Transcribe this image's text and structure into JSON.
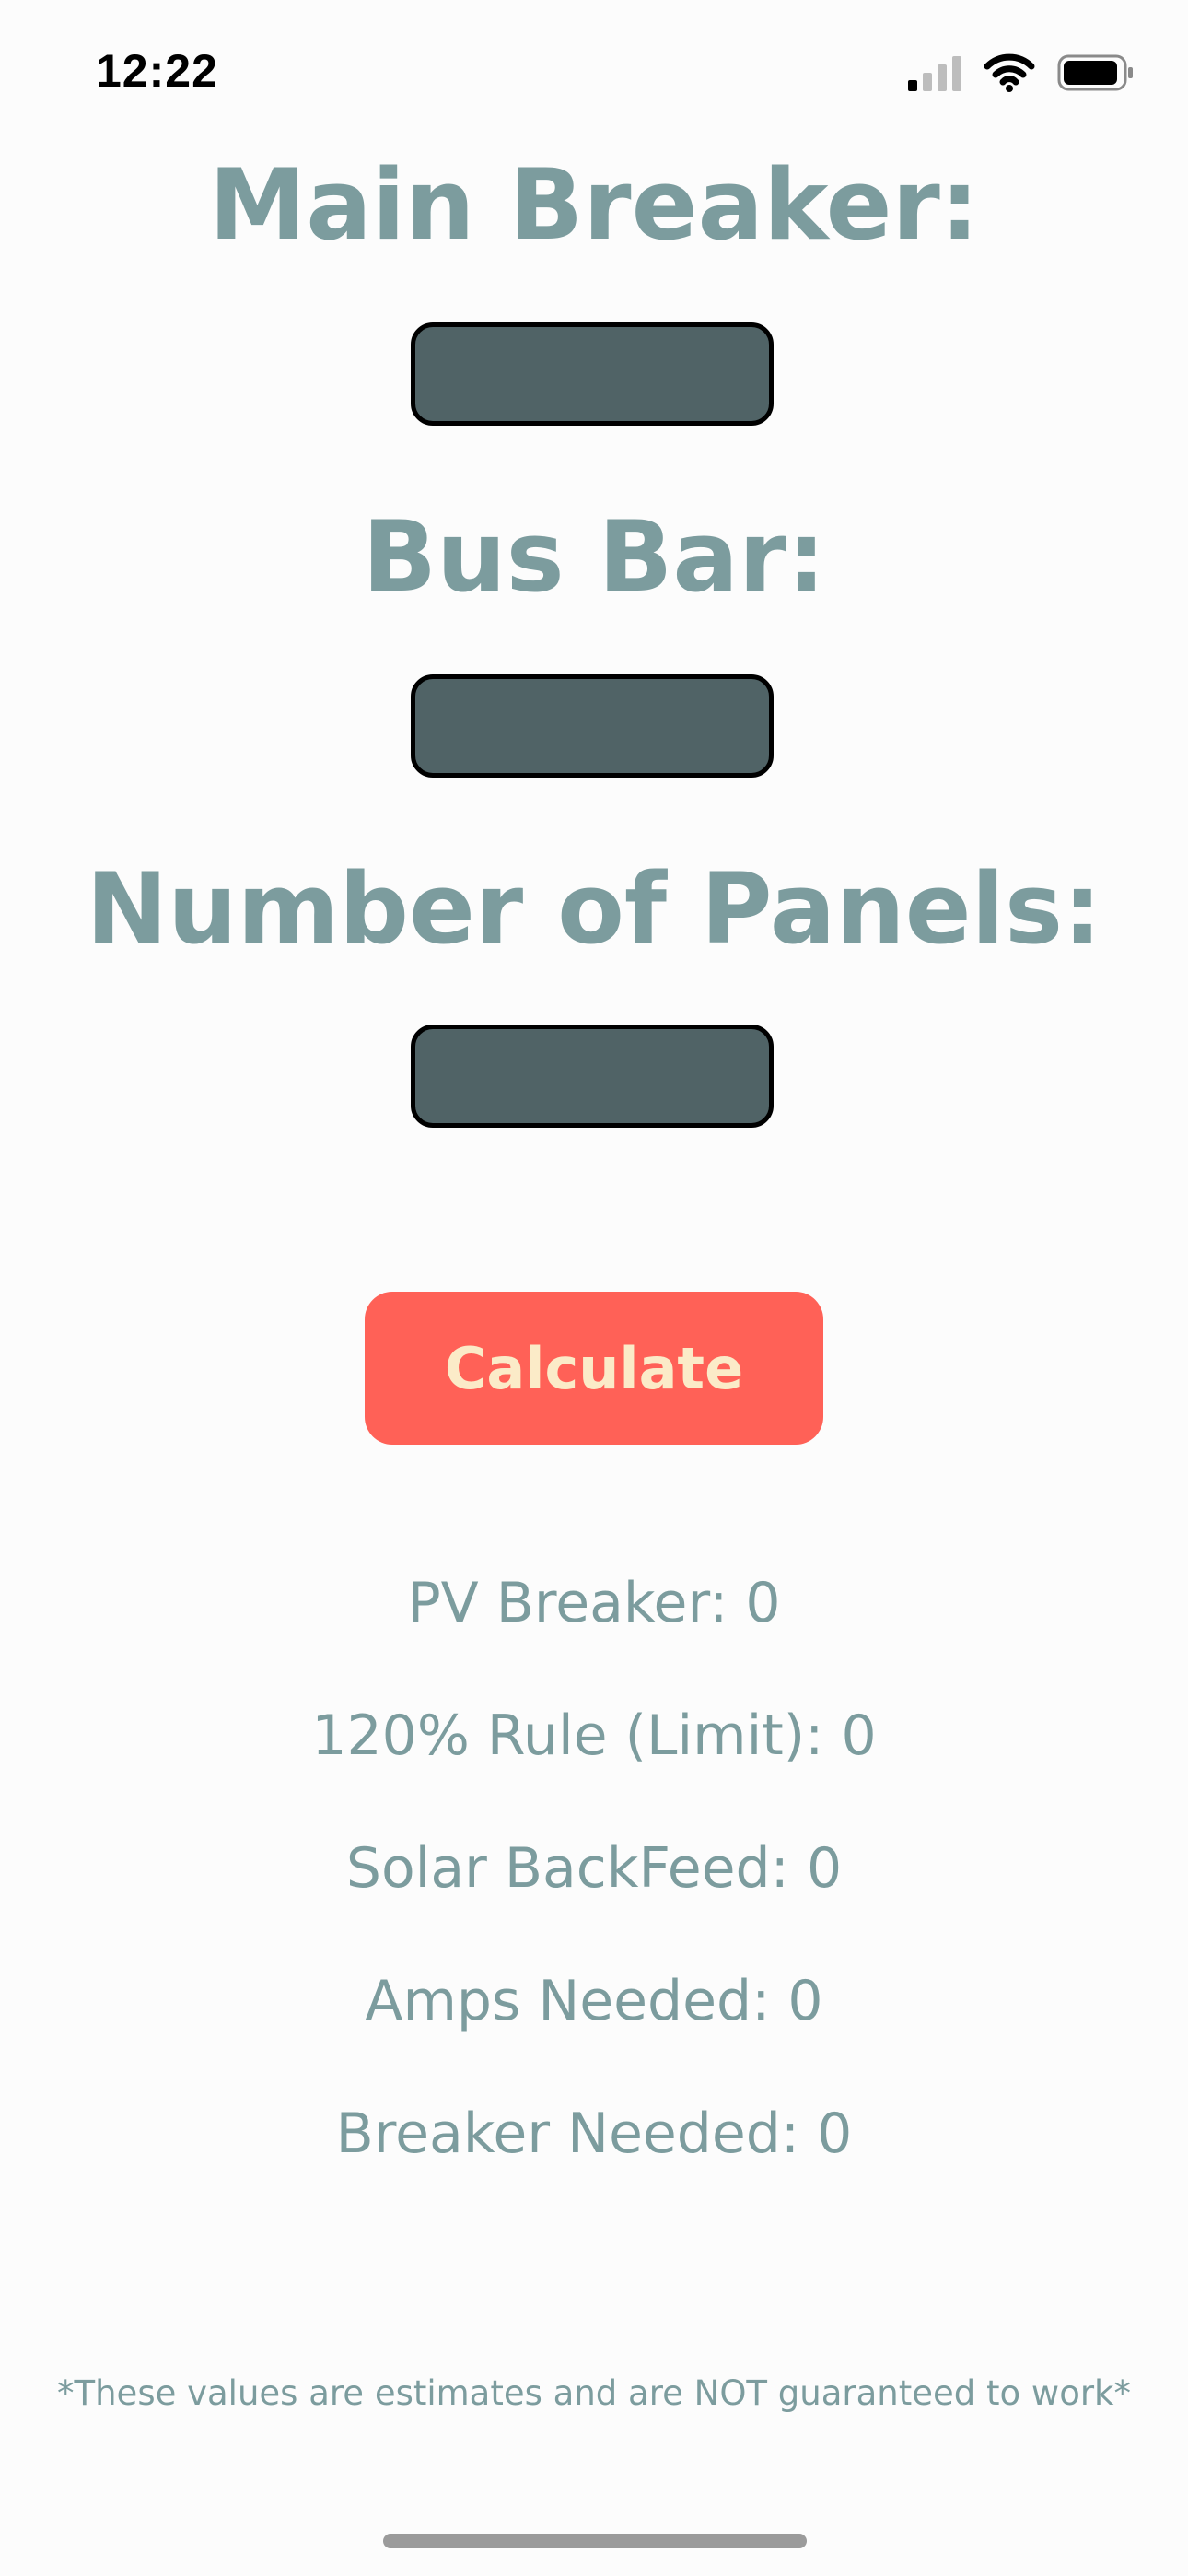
{
  "status_bar": {
    "time": "12:22",
    "icons": [
      "cellular-signal-icon",
      "wifi-icon",
      "battery-icon"
    ]
  },
  "form": {
    "main_breaker": {
      "label": "Main Breaker:",
      "value": ""
    },
    "bus_bar": {
      "label": "Bus Bar:",
      "value": ""
    },
    "number_of_panels": {
      "label": "Number of Panels:",
      "value": ""
    }
  },
  "calculate_button": {
    "label": "Calculate"
  },
  "results": {
    "pv_breaker": {
      "label": "PV Breaker:",
      "value": "0"
    },
    "rule_120_limit": {
      "label": "120% Rule (Limit):",
      "value": "0"
    },
    "solar_backfeed": {
      "label": "Solar BackFeed:",
      "value": "0"
    },
    "amps_needed": {
      "label": "Amps Needed:",
      "value": "0"
    },
    "breaker_needed": {
      "label": "Breaker Needed:",
      "value": "0"
    }
  },
  "disclaimer": "*These values are estimates and are NOT guaranteed to work*",
  "colors": {
    "heading": "#7c9c9e",
    "input_fill": "#506366",
    "button_fill": "#ff6157",
    "button_text": "#fbebc8",
    "background": "#fcfcfc"
  }
}
